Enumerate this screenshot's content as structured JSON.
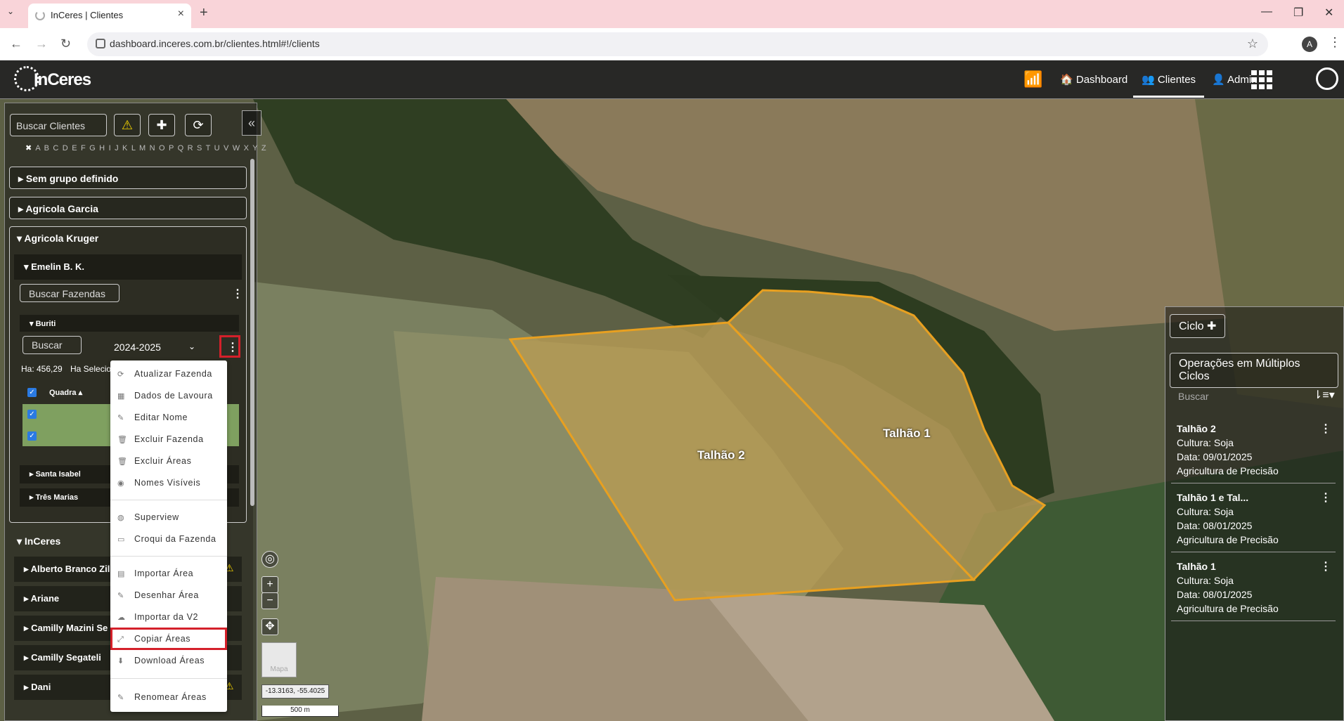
{
  "browser": {
    "tab_title": "InCeres | Clientes",
    "url": "dashboard.inceres.com.br/clientes.html#!/clients",
    "profile_initial": "A"
  },
  "app": {
    "logo": "InCeres",
    "nav": [
      {
        "label": "Dashboard"
      },
      {
        "label": "Clientes"
      },
      {
        "label": "Admin"
      }
    ]
  },
  "left": {
    "search_placeholder": "Buscar Clientes",
    "alphabet": "A B C D E F G H I J K L M N O P Q R S T U V W X Y Z",
    "groups": [
      {
        "label": "Sem grupo definido"
      },
      {
        "label": "Agricola Garcia"
      },
      {
        "label": "Agricola Kruger"
      }
    ],
    "person": "Emelin B. K.",
    "farm_search": "Buscar Fazendas",
    "farm": "Buriti",
    "buscar": "Buscar",
    "season": "2024-2025",
    "ha_total": "Ha: 456,29",
    "ha_selected": "Ha Selecio",
    "col_quadra": "Quadra",
    "other_farms": [
      "Santa Isabel",
      "Três Marias"
    ],
    "group2": "InCeres",
    "people": [
      "Alberto Branco Zil",
      "Ariane",
      "Camilly Mazini Se",
      "Camilly Segateli",
      "Dani"
    ]
  },
  "context_menu": {
    "items": [
      {
        "label": "Atualizar Fazenda",
        "icon": "refresh-icon"
      },
      {
        "label": "Dados de Lavoura",
        "icon": "table-icon"
      },
      {
        "label": "Editar Nome",
        "icon": "pencil-icon"
      },
      {
        "label": "Excluir Fazenda",
        "icon": "trash-icon"
      },
      {
        "label": "Excluir Áreas",
        "icon": "trash-icon"
      },
      {
        "label": "Nomes Visíveis",
        "icon": "eye-icon"
      },
      {
        "label": "Superview",
        "icon": "globe-icon"
      },
      {
        "label": "Croqui da Fazenda",
        "icon": "map-icon"
      },
      {
        "label": "Importar Área",
        "icon": "upload-icon"
      },
      {
        "label": "Desenhar Área",
        "icon": "pencil-icon"
      },
      {
        "label": "Importar da V2",
        "icon": "cloud-icon"
      },
      {
        "label": "Copiar Áreas",
        "icon": "copy-icon"
      },
      {
        "label": "Download Áreas",
        "icon": "download-icon"
      },
      {
        "label": "Renomear Áreas",
        "icon": "pencil-icon"
      }
    ]
  },
  "map": {
    "field1": "Talhão 1",
    "field2": "Talhão 2",
    "coords": "-13.3163, -55.4025",
    "scale": "500 m",
    "minimap_label": "Mapa"
  },
  "right": {
    "ciclo": "Ciclo",
    "multi": "Operações em Múltiplos Ciclos",
    "search": "Buscar",
    "cards": [
      {
        "title": "Talhão 2",
        "cultura": "Cultura: Soja",
        "data": "Data: 09/01/2025",
        "tipo": "Agricultura de Precisão"
      },
      {
        "title": "Talhão 1 e Tal...",
        "cultura": "Cultura: Soja",
        "data": "Data: 08/01/2025",
        "tipo": "Agricultura de Precisão"
      },
      {
        "title": "Talhão 1",
        "cultura": "Cultura: Soja",
        "data": "Data: 08/01/2025",
        "tipo": "Agricultura de Precisão"
      }
    ]
  }
}
